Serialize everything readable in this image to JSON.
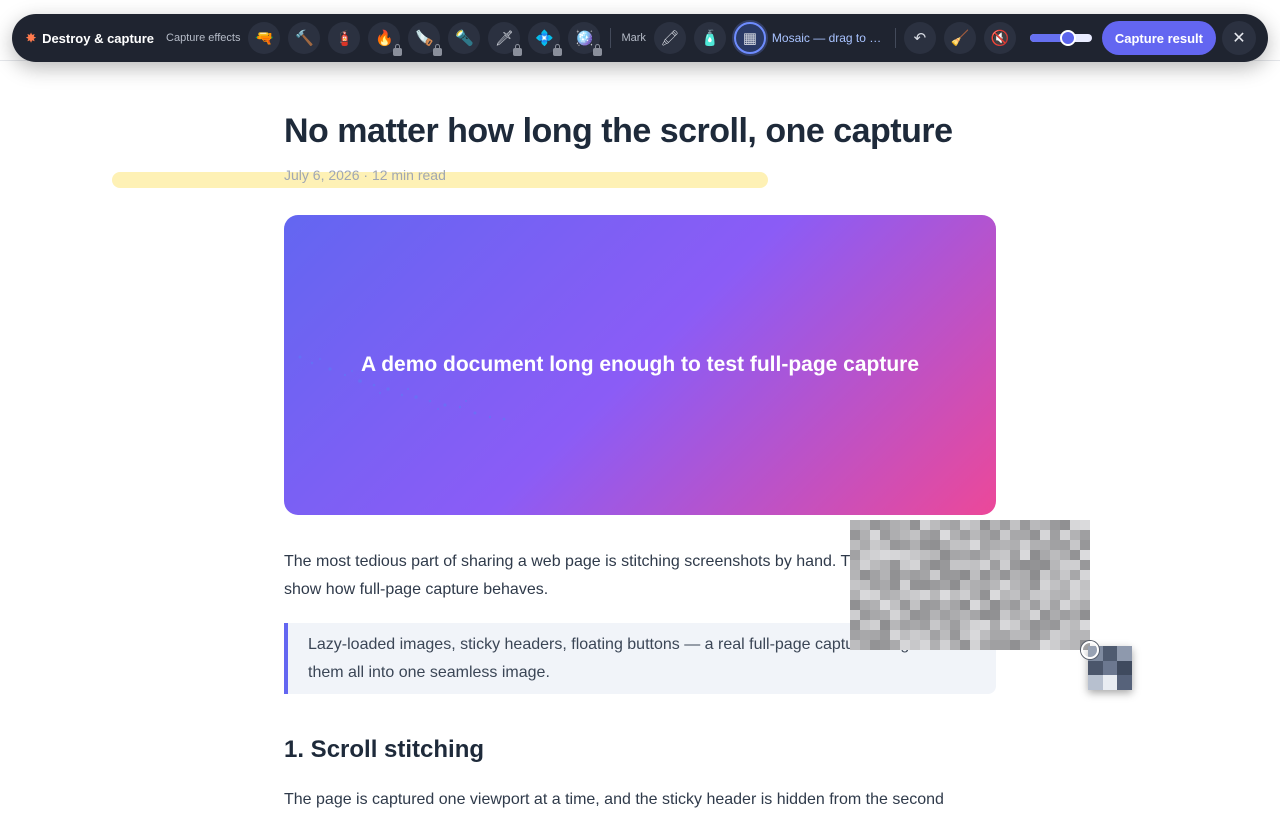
{
  "toolbar": {
    "brand_icon": "explosion-icon",
    "brand_label": "Destroy & capture",
    "capture_effects_label": "Capture effects",
    "capture_tools": [
      {
        "name": "gun-tool",
        "glyph": "🔫",
        "locked": false
      },
      {
        "name": "hammer-tool",
        "glyph": "🔨",
        "locked": false
      },
      {
        "name": "stamp-tool",
        "glyph": "🧯",
        "locked": false
      },
      {
        "name": "flamethrower-tool",
        "glyph": "🔥",
        "locked": true
      },
      {
        "name": "chainsaw-tool",
        "glyph": "🪚",
        "locked": true
      },
      {
        "name": "laser-tool",
        "glyph": "🔦",
        "locked": false
      },
      {
        "name": "rifle-tool",
        "glyph": "🗡",
        "locked": true
      },
      {
        "name": "plasma-tool",
        "glyph": "💠",
        "locked": true
      },
      {
        "name": "ray-tool",
        "glyph": "🪩",
        "locked": true
      }
    ],
    "mark_label": "Mark",
    "mark_tools": [
      {
        "name": "highlighter-tool",
        "glyph": "🖍",
        "active": false
      },
      {
        "name": "spray-tool",
        "glyph": "🧴",
        "active": false
      },
      {
        "name": "mosaic-tool",
        "glyph": "▦",
        "active": true
      }
    ],
    "active_tool_status": "Mosaic — drag to cove...",
    "action_tools": [
      {
        "name": "undo-icon",
        "glyph": "↶"
      },
      {
        "name": "broom-icon",
        "glyph": "🧹"
      },
      {
        "name": "mute-icon",
        "glyph": "🔇"
      }
    ],
    "brush_size_fraction": 0.62,
    "capture_button_label": "Capture result",
    "close_icon": "close-icon",
    "close_glyph": "✕"
  },
  "article": {
    "title": "No matter how long the scroll, one capture",
    "meta": "July 6, 2026 · 12 min read",
    "hero_title": "A demo document long enough to test full-page capture",
    "paragraph1": "The most tedious part of sharing a web page is stitching screenshots by hand. This page exists to show how full-page capture behaves.",
    "quote": "Lazy-loaded images, sticky headers, floating buttons — a real full-page capture merges them all into one seamless image.",
    "section1_heading": "1. Scroll stitching",
    "paragraph2": "The page is captured one viewport at a time, and the sticky header is hidden from the second"
  },
  "colors": {
    "toolbar_bg": "#1f2430",
    "accent": "#6366f1",
    "hero_gradient": [
      "#6366f1",
      "#8b5cf6",
      "#ec4899"
    ],
    "highlighter": "#fde678"
  }
}
